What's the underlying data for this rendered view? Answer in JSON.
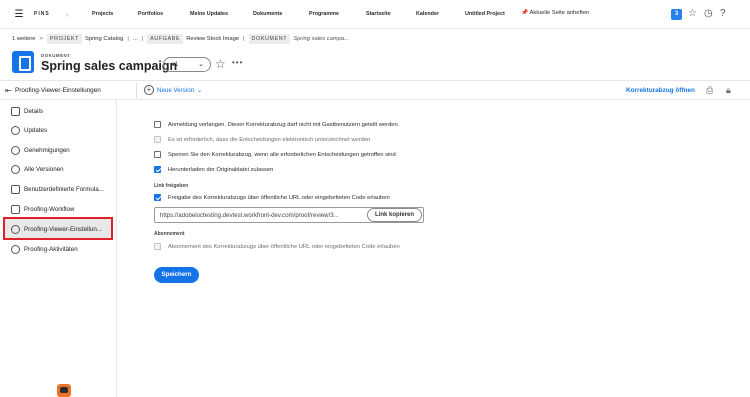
{
  "topbar": {
    "pins": "PINS",
    "nav": [
      "Projects",
      "Portfolios",
      "Meine Updates",
      "Dokumente",
      "Programme",
      "Startseite",
      "Kalender",
      "Untitled Project"
    ],
    "pin_page": "Aktuelle Seite anheften",
    "notification_count": "3"
  },
  "breadcrumb": {
    "more": "1 weitere",
    "project_tag": "PROJEKT",
    "project": "Spring Catalog",
    "ellipsis": "...",
    "task_tag": "AUFGABE",
    "task": "Review Stock Image",
    "doc_tag": "DOKUMENT",
    "doc": "Spring sales campa..."
  },
  "header": {
    "type_label": "DOKUMENT",
    "title": "Spring sales campaign",
    "version": "v1",
    "more": "•••"
  },
  "toolbar": {
    "section_title": "Proofing-Viewer-Einstellungen",
    "new_version": "Neue Version",
    "open_proof": "Korrekturabzug öffnen"
  },
  "sidebar": {
    "items": [
      {
        "label": "Details",
        "icon": "list-icon"
      },
      {
        "label": "Updates",
        "icon": "chat-icon"
      },
      {
        "label": "Genehmigungen",
        "icon": "check-circle-icon"
      },
      {
        "label": "Alle Versionen",
        "icon": "layers-icon"
      },
      {
        "label": "Benutzerdefinierte Formula...",
        "icon": "form-icon"
      },
      {
        "label": "Proofing-Workflow",
        "icon": "workflow-icon"
      },
      {
        "label": "Proofing-Viewer-Einstellun...",
        "icon": "gear-icon"
      },
      {
        "label": "Proofing-Aktivitäten",
        "icon": "activity-icon"
      }
    ],
    "active_index": 6
  },
  "settings": {
    "options": [
      {
        "label": "Anmeldung verlangen. Dieser Korrekturabzug darf nicht mit Gastbenutzern geteilt werden.",
        "checked": false,
        "disabled": false
      },
      {
        "label": "Es ist erforderlich, dass die Entscheidungen elektronisch unterzeichnet werden",
        "checked": false,
        "disabled": true
      },
      {
        "label": "Sperren Sie den Korrekturabzug, wenn alle erforderlichen Entscheidungen getroffen sind",
        "checked": false,
        "disabled": false
      },
      {
        "label": "Herunterladen der Originaldatei zulassen",
        "checked": true,
        "disabled": false
      }
    ],
    "link_section": "Link freigeben",
    "link_option": {
      "label": "Freigabe des Korrekturabzugs über öffentliche URL oder eingebetteten Code erlauben",
      "checked": true
    },
    "url": "https://adobeloctesting.devtest.workfront-dev.com/proof/review/3...",
    "copy_button": "Link kopieren",
    "subscription_section": "Abonnement",
    "subscription_option": {
      "label": "Abonnement des Korrekturabzugs über öffentliche URL oder eingebetteten Code erlauben",
      "checked": false,
      "disabled": true
    },
    "save": "Speichern"
  },
  "colors": {
    "accent": "#1473e6",
    "highlight": "#e0202b"
  }
}
